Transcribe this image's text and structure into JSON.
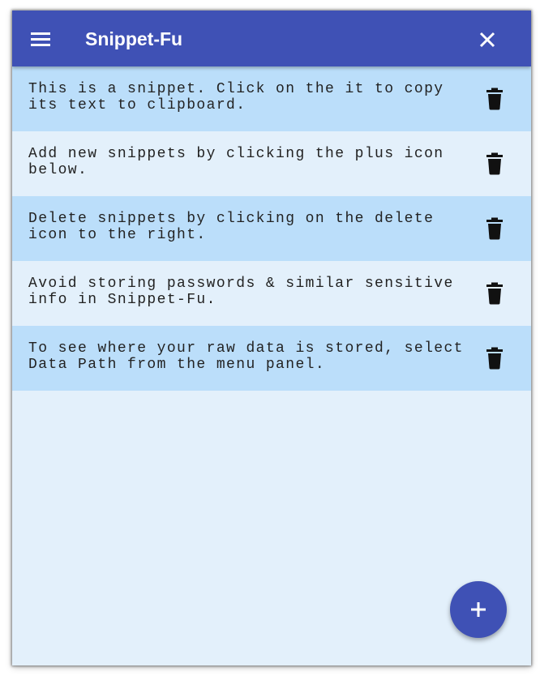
{
  "app": {
    "title": "Snippet-Fu"
  },
  "header": {
    "menu_icon": "hamburger-menu-icon",
    "close_icon": "close-icon"
  },
  "snippets": [
    {
      "text": "This is a snippet. Click on the it to copy its text to clipboard."
    },
    {
      "text": "Add new snippets by clicking the plus icon below."
    },
    {
      "text": "Delete snippets by clicking on the delete icon to the right."
    },
    {
      "text": "Avoid storing passwords & similar sensitive info in Snippet-Fu."
    },
    {
      "text": "To see where your raw data is stored, select Data Path from the menu panel."
    }
  ],
  "fab": {
    "icon": "plus-icon"
  },
  "colors": {
    "primary": "#3f51b5",
    "row_alt": "#bbdefa",
    "background": "#e3f0fb"
  }
}
